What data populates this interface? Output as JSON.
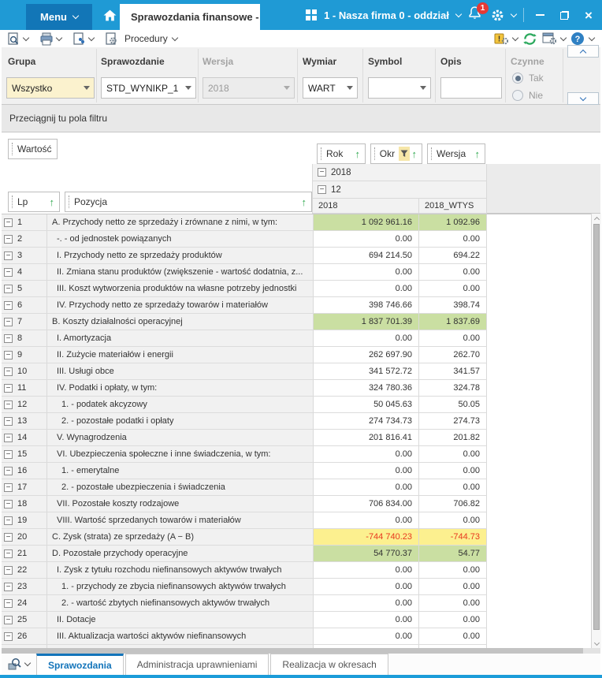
{
  "titlebar": {
    "menu_label": "Menu",
    "tab_title": "Sprawozdania finansowe - a",
    "company": "1 - Nasza firma 0 - oddział",
    "notification_count": "1"
  },
  "toolbar": {
    "procedury_label": "Procedury"
  },
  "filters": {
    "grupa": {
      "label": "Grupa",
      "value": "Wszystko"
    },
    "sprawozdanie": {
      "label": "Sprawozdanie",
      "value": "STD_WYNIKP_1"
    },
    "wersja": {
      "label": "Wersja",
      "value": "2018",
      "disabled": true
    },
    "wymiar": {
      "label": "Wymiar",
      "value": "WART"
    },
    "symbol": {
      "label": "Symbol",
      "value": ""
    },
    "opis": {
      "label": "Opis",
      "value": ""
    },
    "czynne": {
      "label": "Czynne",
      "option_yes": "Tak",
      "option_no": "Nie",
      "selected": "Tak"
    }
  },
  "filter_drop_zone": "Przeciągnij tu pola filtru",
  "pivot": {
    "data_field": "Wartość",
    "column_fields": [
      {
        "label": "Rok",
        "sorted": true,
        "filtered": false
      },
      {
        "label": "Okr",
        "sorted": true,
        "filtered": true
      },
      {
        "label": "Wersja",
        "sorted": true,
        "filtered": false
      }
    ],
    "row_fields": [
      {
        "label": "Lp"
      },
      {
        "label": "Pozycja"
      }
    ],
    "group_year": "2018",
    "group_period": "12",
    "column_headers": [
      "2018",
      "2018_WTYS"
    ],
    "rows": [
      {
        "lp": "1",
        "pozycja": "A. Przychody netto ze sprzedaży i zrównane z nimi, w tym:",
        "indent": 0,
        "v1": "1 092 961.16",
        "v2": "1 092.96",
        "hl": "green"
      },
      {
        "lp": "2",
        "pozycja": "-.  - od jednostek powiązanych",
        "indent": 1,
        "v1": "0.00",
        "v2": "0.00",
        "hl": ""
      },
      {
        "lp": "3",
        "pozycja": "I. Przychody netto ze sprzedaży produktów",
        "indent": 1,
        "v1": "694 214.50",
        "v2": "694.22",
        "hl": ""
      },
      {
        "lp": "4",
        "pozycja": "II. Zmiana stanu produktów (zwiększenie - wartość dodatnia, z...",
        "indent": 1,
        "v1": "0.00",
        "v2": "0.00",
        "hl": ""
      },
      {
        "lp": "5",
        "pozycja": "III. Koszt wytworzenia produktów na własne potrzeby jednostki",
        "indent": 1,
        "v1": "0.00",
        "v2": "0.00",
        "hl": ""
      },
      {
        "lp": "6",
        "pozycja": "IV. Przychody netto ze sprzedaży towarów i materiałów",
        "indent": 1,
        "v1": "398 746.66",
        "v2": "398.74",
        "hl": ""
      },
      {
        "lp": "7",
        "pozycja": "B. Koszty działalności operacyjnej",
        "indent": 0,
        "v1": "1 837 701.39",
        "v2": "1 837.69",
        "hl": "green"
      },
      {
        "lp": "8",
        "pozycja": "I. Amortyzacja",
        "indent": 1,
        "v1": "0.00",
        "v2": "0.00",
        "hl": ""
      },
      {
        "lp": "9",
        "pozycja": "II. Zużycie materiałów i energii",
        "indent": 1,
        "v1": "262 697.90",
        "v2": "262.70",
        "hl": ""
      },
      {
        "lp": "10",
        "pozycja": "III. Usługi obce",
        "indent": 1,
        "v1": "341 572.72",
        "v2": "341.57",
        "hl": ""
      },
      {
        "lp": "11",
        "pozycja": "IV. Podatki i opłaty, w tym:",
        "indent": 1,
        "v1": "324 780.36",
        "v2": "324.78",
        "hl": ""
      },
      {
        "lp": "12",
        "pozycja": "1. - podatek akcyzowy",
        "indent": 2,
        "v1": "50 045.63",
        "v2": "50.05",
        "hl": ""
      },
      {
        "lp": "13",
        "pozycja": "2. - pozostałe podatki i opłaty",
        "indent": 2,
        "v1": "274 734.73",
        "v2": "274.73",
        "hl": ""
      },
      {
        "lp": "14",
        "pozycja": "V. Wynagrodzenia",
        "indent": 1,
        "v1": "201 816.41",
        "v2": "201.82",
        "hl": ""
      },
      {
        "lp": "15",
        "pozycja": "VI. Ubezpieczenia społeczne i inne świadczenia, w tym:",
        "indent": 1,
        "v1": "0.00",
        "v2": "0.00",
        "hl": ""
      },
      {
        "lp": "16",
        "pozycja": "1. - emerytalne",
        "indent": 2,
        "v1": "0.00",
        "v2": "0.00",
        "hl": ""
      },
      {
        "lp": "17",
        "pozycja": "2. - pozostałe ubezpieczenia i świadczenia",
        "indent": 2,
        "v1": "0.00",
        "v2": "0.00",
        "hl": ""
      },
      {
        "lp": "18",
        "pozycja": "VII. Pozostałe koszty rodzajowe",
        "indent": 1,
        "v1": "706 834.00",
        "v2": "706.82",
        "hl": ""
      },
      {
        "lp": "19",
        "pozycja": "VIII. Wartość sprzedanych towarów i materiałów",
        "indent": 1,
        "v1": "0.00",
        "v2": "0.00",
        "hl": ""
      },
      {
        "lp": "20",
        "pozycja": "C. Zysk (strata) ze sprzedaży (A − B)",
        "indent": 0,
        "v1": "-744 740.23",
        "v2": "-744.73",
        "hl": "yellow"
      },
      {
        "lp": "21",
        "pozycja": "D. Pozostałe przychody operacyjne",
        "indent": 0,
        "v1": "54 770.37",
        "v2": "54.77",
        "hl": "green"
      },
      {
        "lp": "22",
        "pozycja": "I. Zysk z tytułu rozchodu niefinansowych aktywów trwałych",
        "indent": 1,
        "v1": "0.00",
        "v2": "0.00",
        "hl": ""
      },
      {
        "lp": "23",
        "pozycja": "1. - przychody ze zbycia niefinansowych aktywów trwałych",
        "indent": 2,
        "v1": "0.00",
        "v2": "0.00",
        "hl": ""
      },
      {
        "lp": "24",
        "pozycja": "2. - wartość zbytych niefinansowych aktywów trwałych",
        "indent": 2,
        "v1": "0.00",
        "v2": "0.00",
        "hl": ""
      },
      {
        "lp": "25",
        "pozycja": "II. Dotacje",
        "indent": 1,
        "v1": "0.00",
        "v2": "0.00",
        "hl": ""
      },
      {
        "lp": "26",
        "pozycja": "III. Aktualizacja wartości aktywów niefinansowych",
        "indent": 1,
        "v1": "0.00",
        "v2": "0.00",
        "hl": ""
      }
    ]
  },
  "bottom_tabs": {
    "tab1": "Sprawozdania",
    "tab2": "Administracja uprawnieniami",
    "tab3": "Realizacja w okresach",
    "active": "Sprawozdania"
  },
  "icons": {
    "collapse": "−",
    "sort_asc": "↑",
    "close": "×",
    "help": "?",
    "alert": "!"
  },
  "colors": {
    "titlebar": "#1f9ad5",
    "accent": "#1b9cd9",
    "menu_button": "#1276b7",
    "green_highlight": "#cadfa2",
    "yellow_highlight": "#fcf08f",
    "negative_text": "#e8391f",
    "sort_arrow": "#2fa84f",
    "active_tab_text": "#1374ba",
    "refresh_green": "#2aa85c",
    "help_blue": "#2f80c3",
    "filter_yellow_bg": "#fbf2ce"
  }
}
